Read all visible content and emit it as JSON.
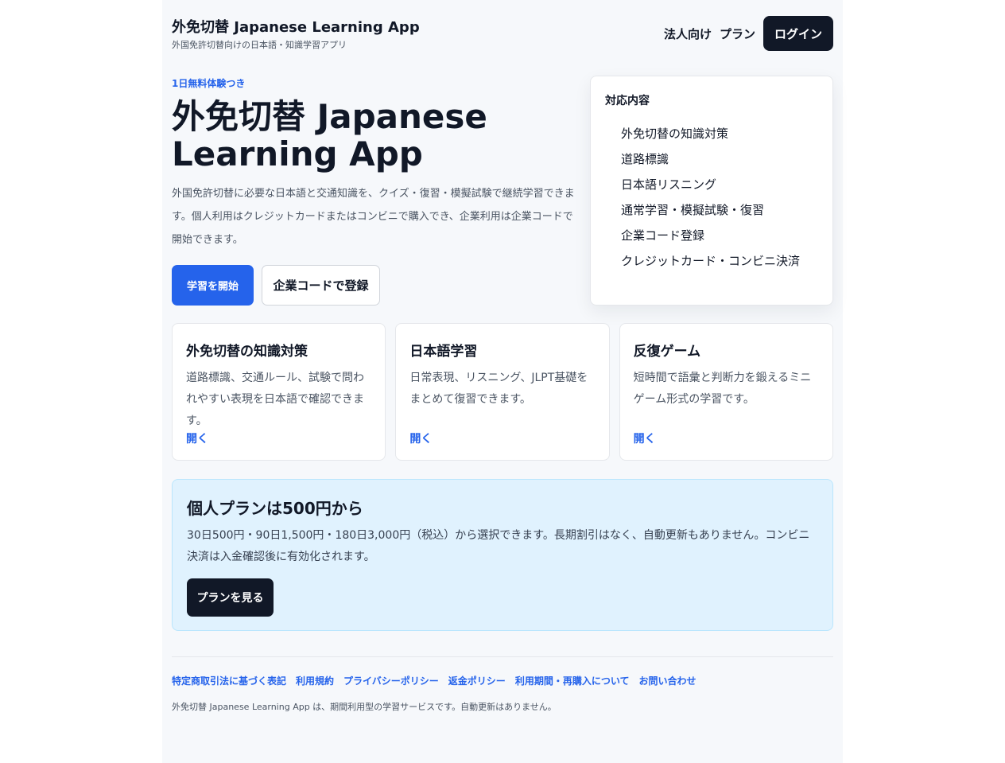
{
  "header": {
    "title": "外免切替 Japanese Learning App",
    "subtitle": "外国免許切替向けの日本語・知識学習アプリ",
    "nav": {
      "business": "法人向け",
      "plans": "プラン",
      "login": "ログイン"
    }
  },
  "hero": {
    "badge": "1日無料体験つき",
    "title": "外免切替 Japanese Learning App",
    "description": "外国免許切替に必要な日本語と交通知識を、クイズ・復習・模擬試験で継続学習できます。個人利用はクレジットカードまたはコンビニで購入でき、企業利用は企業コードで開始できます。",
    "primary_button": "学習を開始",
    "secondary_button": "企業コードで登録"
  },
  "coverage": {
    "title": "対応内容",
    "items": [
      "外免切替の知識対策",
      "道路標識",
      "日本語リスニング",
      "通常学習・模擬試験・復習",
      "企業コード登録",
      "クレジットカード・コンビニ決済"
    ]
  },
  "cards": [
    {
      "title": "外免切替の知識対策",
      "description": "道路標識、交通ルール、試験で問われやすい表現を日本語で確認できます。",
      "link": "開く"
    },
    {
      "title": "日本語学習",
      "description": "日常表現、リスニング、JLPT基礎をまとめて復習できます。",
      "link": "開く"
    },
    {
      "title": "反復ゲーム",
      "description": "短時間で語彙と判断力を鍛えるミニゲーム形式の学習です。",
      "link": "開く"
    }
  ],
  "plan": {
    "title": "個人プランは500円から",
    "description": "30日500円・90日1,500円・180日3,000円（税込）から選択できます。長期割引はなく、自動更新もありません。コンビニ決済は入金確認後に有効化されます。",
    "button": "プランを見る"
  },
  "footer": {
    "links": [
      "特定商取引法に基づく表記",
      "利用規約",
      "プライバシーポリシー",
      "返金ポリシー",
      "利用期間・再購入について",
      "お問い合わせ"
    ],
    "note": "外免切替 Japanese Learning App は、期間利用型の学習サービスです。自動更新はありません。"
  },
  "colors": {
    "primary": "#2563eb",
    "dark": "#111827",
    "page_background": "#f6f8fb",
    "plan_background": "#e0f2fe"
  }
}
